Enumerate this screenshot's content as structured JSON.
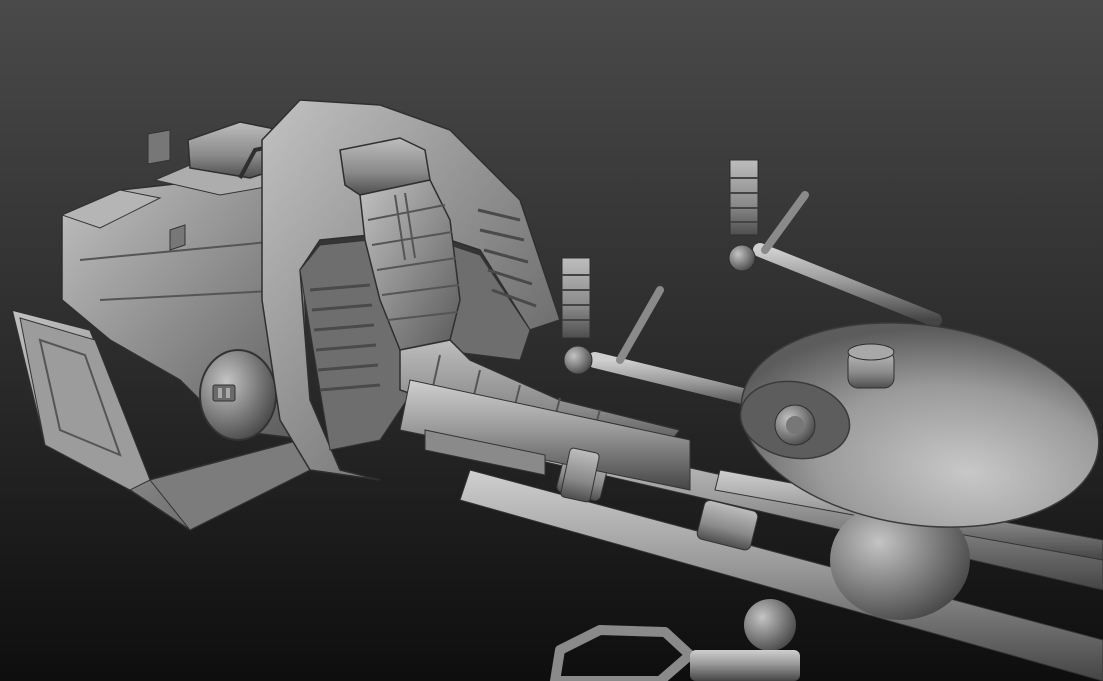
{
  "scene": {
    "subject": "",
    "background_top": "#4a4a4a",
    "background_bottom": "#0e0e0e",
    "material_light": "#b9b9b9",
    "material_mid": "#8f8f8f",
    "material_dark": "#3c3c3c"
  }
}
